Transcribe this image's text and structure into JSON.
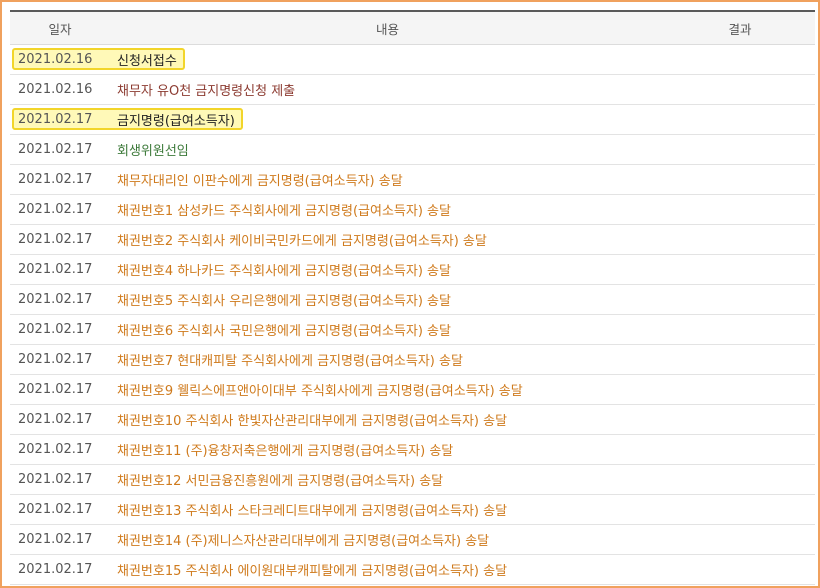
{
  "table": {
    "headers": {
      "date": "일자",
      "content": "내용",
      "result": "결과"
    },
    "rows": [
      {
        "date": "2021.02.16",
        "content": "신청서접수",
        "highlighted": true,
        "color": "#222222"
      },
      {
        "date": "2021.02.16",
        "content": "채무자 유O천 금지명령신청 제출",
        "highlighted": false,
        "color": "#8c3b31"
      },
      {
        "date": "2021.02.17",
        "content": "금지명령(급여소득자)",
        "highlighted": true,
        "color": "#222222"
      },
      {
        "date": "2021.02.17",
        "content": "회생위원선임",
        "highlighted": false,
        "color": "#3d7a3a"
      },
      {
        "date": "2021.02.17",
        "content": "채무자대리인 이판수에게 금지명령(급여소득자) 송달",
        "highlighted": false,
        "color": "#cf7a1c"
      },
      {
        "date": "2021.02.17",
        "content": "채권번호1 삼성카드 주식회사에게 금지명령(급여소득자) 송달",
        "highlighted": false,
        "color": "#cf7a1c"
      },
      {
        "date": "2021.02.17",
        "content": "채권번호2 주식회사 케이비국민카드에게 금지명령(급여소득자) 송달",
        "highlighted": false,
        "color": "#cf7a1c"
      },
      {
        "date": "2021.02.17",
        "content": "채권번호4 하나카드 주식회사에게 금지명령(급여소득자) 송달",
        "highlighted": false,
        "color": "#cf7a1c"
      },
      {
        "date": "2021.02.17",
        "content": "채권번호5 주식회사 우리은행에게 금지명령(급여소득자) 송달",
        "highlighted": false,
        "color": "#cf7a1c"
      },
      {
        "date": "2021.02.17",
        "content": "채권번호6 주식회사 국민은행에게 금지명령(급여소득자) 송달",
        "highlighted": false,
        "color": "#cf7a1c"
      },
      {
        "date": "2021.02.17",
        "content": "채권번호7 현대캐피탈 주식회사에게 금지명령(급여소득자) 송달",
        "highlighted": false,
        "color": "#cf7a1c"
      },
      {
        "date": "2021.02.17",
        "content": "채권번호9 웰릭스에프앤아이대부 주식회사에게 금지명령(급여소득자) 송달",
        "highlighted": false,
        "color": "#cf7a1c"
      },
      {
        "date": "2021.02.17",
        "content": "채권번호10 주식회사 한빛자산관리대부에게 금지명령(급여소득자) 송달",
        "highlighted": false,
        "color": "#cf7a1c"
      },
      {
        "date": "2021.02.17",
        "content": "채권번호11 (주)융창저축은행에게 금지명령(급여소득자) 송달",
        "highlighted": false,
        "color": "#cf7a1c"
      },
      {
        "date": "2021.02.17",
        "content": "채권번호12 서민금융진흥원에게 금지명령(급여소득자) 송달",
        "highlighted": false,
        "color": "#cf7a1c"
      },
      {
        "date": "2021.02.17",
        "content": "채권번호13 주식회사 스타크레디트대부에게 금지명령(급여소득자) 송달",
        "highlighted": false,
        "color": "#cf7a1c"
      },
      {
        "date": "2021.02.17",
        "content": "채권번호14 (주)제니스자산관리대부에게 금지명령(급여소득자) 송달",
        "highlighted": false,
        "color": "#cf7a1c"
      },
      {
        "date": "2021.02.17",
        "content": "채권번호15 주식회사 에이원대부캐피탈에게 금지명령(급여소득자) 송달",
        "highlighted": false,
        "color": "#cf7a1c"
      }
    ]
  }
}
